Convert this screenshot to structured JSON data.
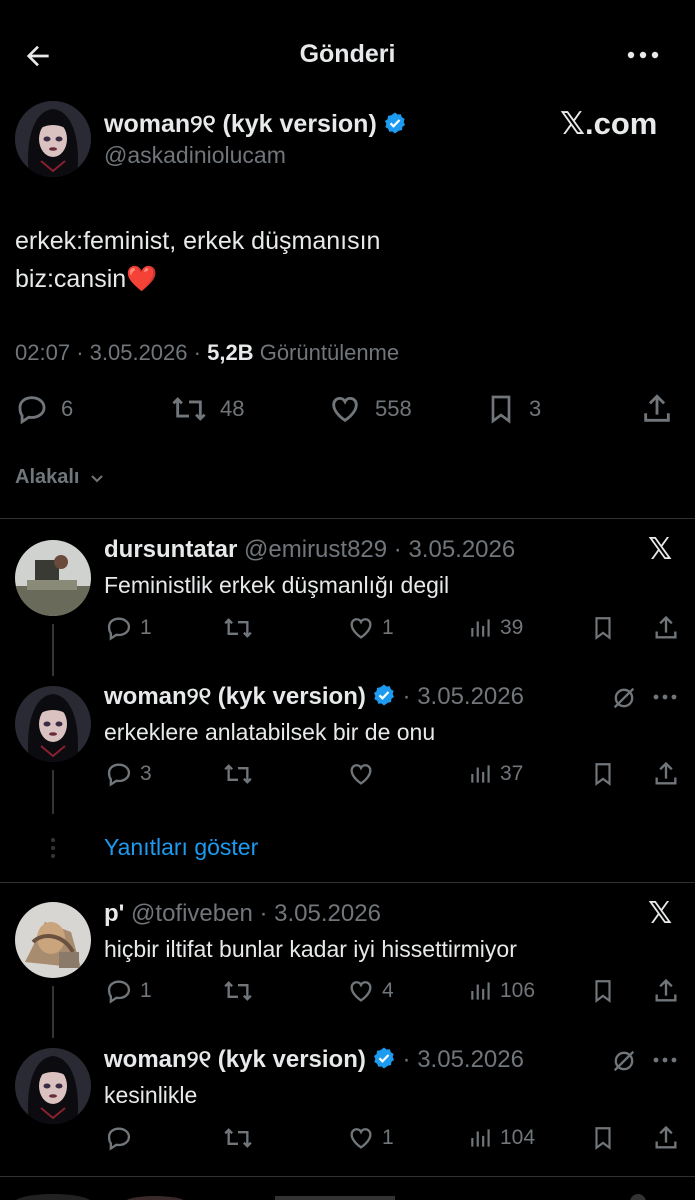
{
  "header": {
    "title": "Gönderi"
  },
  "post": {
    "author_name": "woman୨୧ (kyk version)",
    "author_handle": "@askadiniolucam",
    "source_logo": "𝕏.com",
    "text_line1": "erkek:feminist, erkek düşmanısın",
    "text_line2": "biz:cansin",
    "emoji": "❤️",
    "time": "02:07",
    "date": "3.05.2026",
    "views_count": "5,2B",
    "views_label": "Görüntülenme",
    "replies": "6",
    "reposts": "48",
    "likes": "558",
    "bookmarks": "3"
  },
  "sort": {
    "label": "Alakalı"
  },
  "replies": [
    {
      "name": "dursuntatar",
      "handle": "@emirust829",
      "date": "· 3.05.2026",
      "text": "Feministlik erkek düşmanlığı degil",
      "replies": "1",
      "reposts": "",
      "likes": "1",
      "views": "39"
    },
    {
      "name": "woman୨୧ (kyk version)",
      "handle": "",
      "date": "· 3.05.2026",
      "text": "erkeklere anlatabilsek bir de onu",
      "replies": "3",
      "reposts": "",
      "likes": "",
      "views": "37"
    },
    {
      "name": "p'",
      "handle": "@tofiveben",
      "date": "· 3.05.2026",
      "text": "hiçbir iltifat bunlar kadar iyi hissettirmiyor",
      "replies": "1",
      "reposts": "",
      "likes": "4",
      "views": "106"
    },
    {
      "name": "woman୨୧ (kyk version)",
      "handle": "",
      "date": "· 3.05.2026",
      "text": "kesinlikle",
      "replies": "",
      "reposts": "",
      "likes": "1",
      "views": "104"
    }
  ],
  "show_replies": "Yanıtları göster",
  "colors": {
    "background": "#000000",
    "text": "#e7e9ea",
    "muted": "#71767b",
    "accent": "#1d9bf0",
    "like": "#f91880"
  }
}
